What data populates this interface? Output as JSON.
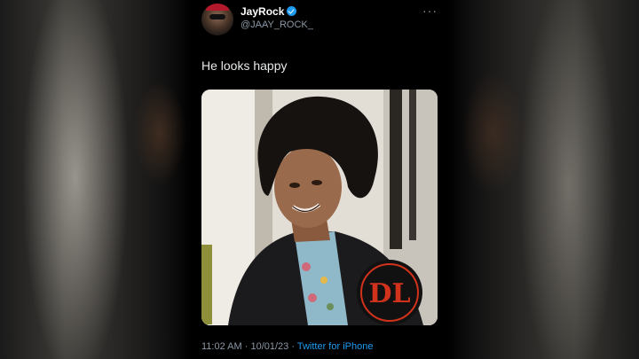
{
  "tweet": {
    "name": "JayRock",
    "handle": "@JAAY_ROCK_",
    "more": "···",
    "text": "He looks happy",
    "time": "11:02 AM",
    "separator": " · ",
    "date": "10/01/23",
    "source": "Twitter for iPhone"
  },
  "icons": {
    "verified": "verified-badge-icon",
    "more": "more-dots-icon"
  },
  "colors": {
    "accent": "#1d9bf0",
    "background": "#000000",
    "watermark_red": "#d0321c"
  },
  "watermark": {
    "letters": "DL"
  }
}
